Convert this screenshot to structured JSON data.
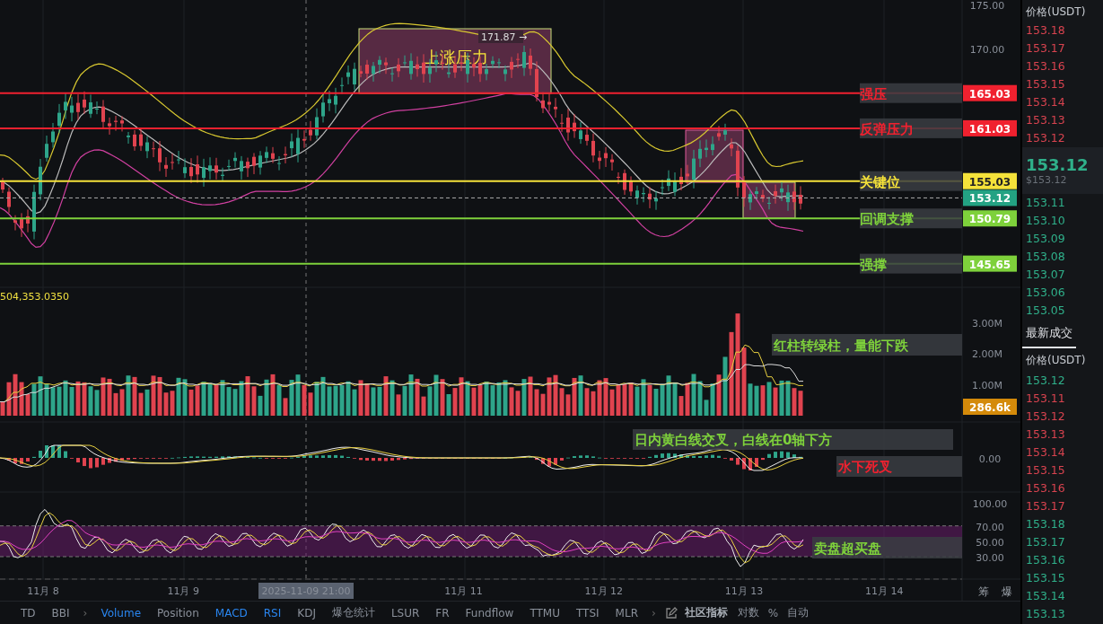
{
  "price_pane": {
    "axis_ticks": [
      "175.00",
      "170.00"
    ],
    "levels": [
      {
        "name": "强压",
        "tag": "165.03",
        "color": "#f0212f"
      },
      {
        "name": "反弹压力",
        "tag": "161.03",
        "color": "#f0212f"
      },
      {
        "name": "关键位",
        "tag": "155.03",
        "color": "#f5e23a"
      },
      {
        "name": "回调支撑",
        "tag": "150.79",
        "color": "#7ed13b"
      },
      {
        "name": "强撑",
        "tag": "145.65",
        "color": "#7ed13b"
      }
    ],
    "last_price_tag": "153.12",
    "zone": {
      "label": "上涨压力",
      "high_marker": "171.87 →"
    }
  },
  "volume_pane": {
    "value_readout": "504,353.0350",
    "axis_ticks": [
      "3.00M",
      "2.00M",
      "1.00M"
    ],
    "last_volume_tag": "286.6k",
    "note": {
      "text": "红柱转绿柱，量能下跌",
      "color": "#7ed13b"
    }
  },
  "macd_pane": {
    "axis_ticks": [
      "0.00"
    ],
    "notes": [
      {
        "text": "日内黄白线交叉，白线在0轴下方",
        "color": "#7ed13b"
      },
      {
        "text": "水下死叉",
        "color": "#f0212f"
      }
    ]
  },
  "rsi_pane": {
    "axis_ticks": [
      "100.00",
      "70.00",
      "50.00",
      "30.00"
    ],
    "note": {
      "text": "卖盘超买盘",
      "color": "#7ed13b"
    }
  },
  "time_axis": {
    "dates": [
      "11月 8",
      "11月 9",
      "11月 11",
      "11月 12",
      "11月 13",
      "11月 14"
    ],
    "crosshair_time": "2025-11-09 21:00",
    "buttons": [
      "筹",
      "爆"
    ]
  },
  "indicator_bar": {
    "items": [
      {
        "kind": "tab",
        "label": "TD",
        "selected": false
      },
      {
        "kind": "tab",
        "label": "BBI",
        "selected": false
      },
      {
        "kind": "more",
        "label": "›"
      },
      {
        "kind": "tab",
        "label": "Volume",
        "selected": true
      },
      {
        "kind": "tab",
        "label": "Position",
        "selected": false
      },
      {
        "kind": "tab",
        "label": "MACD",
        "selected": true
      },
      {
        "kind": "tab",
        "label": "RSI",
        "selected": true
      },
      {
        "kind": "tab",
        "label": "KDJ",
        "selected": false
      },
      {
        "kind": "tab",
        "label": "爆仓统计",
        "selected": false
      },
      {
        "kind": "tab",
        "label": "LSUR",
        "selected": false
      },
      {
        "kind": "tab",
        "label": "FR",
        "selected": false
      },
      {
        "kind": "tab",
        "label": "Fundflow",
        "selected": false
      },
      {
        "kind": "tab",
        "label": "TTMU",
        "selected": false
      },
      {
        "kind": "tab",
        "label": "TTSI",
        "selected": false
      },
      {
        "kind": "tab",
        "label": "MLR",
        "selected": false
      },
      {
        "kind": "more",
        "label": "›"
      },
      {
        "kind": "edit"
      },
      {
        "kind": "heading",
        "label": "社区指标"
      },
      {
        "kind": "option",
        "label": "对数"
      },
      {
        "kind": "option",
        "label": "%"
      },
      {
        "kind": "option",
        "label": "自动"
      }
    ]
  },
  "order_book": {
    "header": "价格(USDT)",
    "asks": [
      "153.18",
      "153.17",
      "153.16",
      "153.15",
      "153.14",
      "153.13",
      "153.12"
    ],
    "last_price": "153.12",
    "last_price_usd": "$153.12",
    "bids": [
      "153.11",
      "153.10",
      "153.09",
      "153.08",
      "153.07",
      "153.06",
      "153.05"
    ]
  },
  "trades": {
    "tabs": [
      {
        "label": "最新成交",
        "selected": true
      }
    ],
    "header": "价格(USDT)",
    "rows": [
      {
        "price": "153.12",
        "color": "#2fb08a"
      },
      {
        "price": "153.11",
        "color": "#d9434f"
      },
      {
        "price": "153.12",
        "color": "#d9434f"
      },
      {
        "price": "153.13",
        "color": "#d9434f"
      },
      {
        "price": "153.14",
        "color": "#d9434f"
      },
      {
        "price": "153.15",
        "color": "#d9434f"
      },
      {
        "price": "153.16",
        "color": "#d9434f"
      },
      {
        "price": "153.17",
        "color": "#d9434f"
      },
      {
        "price": "153.18",
        "color": "#2fb08a"
      },
      {
        "price": "153.17",
        "color": "#2fb08a"
      },
      {
        "price": "153.16",
        "color": "#2fb08a"
      },
      {
        "price": "153.15",
        "color": "#2fb08a"
      },
      {
        "price": "153.14",
        "color": "#2fb08a"
      },
      {
        "price": "153.13",
        "color": "#2fb08a"
      }
    ]
  }
}
